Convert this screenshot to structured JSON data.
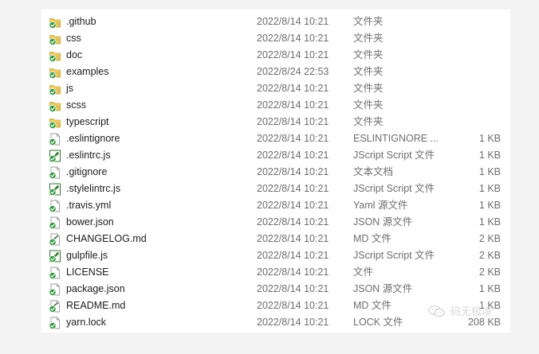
{
  "files": [
    {
      "name": ".github",
      "date": "2022/8/14 10:21",
      "type": "文件夹",
      "size": "",
      "icon": "folder-icon"
    },
    {
      "name": "css",
      "date": "2022/8/14 10:21",
      "type": "文件夹",
      "size": "",
      "icon": "folder-icon"
    },
    {
      "name": "doc",
      "date": "2022/8/14 10:21",
      "type": "文件夹",
      "size": "",
      "icon": "folder-icon"
    },
    {
      "name": "examples",
      "date": "2022/8/24 22:53",
      "type": "文件夹",
      "size": "",
      "icon": "folder-icon"
    },
    {
      "name": "js",
      "date": "2022/8/14 10:21",
      "type": "文件夹",
      "size": "",
      "icon": "folder-icon"
    },
    {
      "name": "scss",
      "date": "2022/8/14 10:21",
      "type": "文件夹",
      "size": "",
      "icon": "folder-icon"
    },
    {
      "name": "typescript",
      "date": "2022/8/14 10:21",
      "type": "文件夹",
      "size": "",
      "icon": "folder-icon"
    },
    {
      "name": ".eslintignore",
      "date": "2022/8/14 10:21",
      "type": "ESLINTIGNORE ...",
      "size": "1 KB",
      "icon": "file-icon"
    },
    {
      "name": ".eslintrc.js",
      "date": "2022/8/14 10:21",
      "type": "JScript Script 文件",
      "size": "1 KB",
      "icon": "script-file-icon"
    },
    {
      "name": ".gitignore",
      "date": "2022/8/14 10:21",
      "type": "文本文档",
      "size": "1 KB",
      "icon": "file-icon"
    },
    {
      "name": ".stylelintrc.js",
      "date": "2022/8/14 10:21",
      "type": "JScript Script 文件",
      "size": "1 KB",
      "icon": "script-file-icon"
    },
    {
      "name": ".travis.yml",
      "date": "2022/8/14 10:21",
      "type": "Yaml 源文件",
      "size": "1 KB",
      "icon": "file-icon"
    },
    {
      "name": "bower.json",
      "date": "2022/8/14 10:21",
      "type": "JSON 源文件",
      "size": "1 KB",
      "icon": "file-icon"
    },
    {
      "name": "CHANGELOG.md",
      "date": "2022/8/14 10:21",
      "type": "MD 文件",
      "size": "2 KB",
      "icon": "md-file-icon"
    },
    {
      "name": "gulpfile.js",
      "date": "2022/8/14 10:21",
      "type": "JScript Script 文件",
      "size": "2 KB",
      "icon": "script-file-icon"
    },
    {
      "name": "LICENSE",
      "date": "2022/8/14 10:21",
      "type": "文件",
      "size": "2 KB",
      "icon": "file-icon"
    },
    {
      "name": "package.json",
      "date": "2022/8/14 10:21",
      "type": "JSON 源文件",
      "size": "1 KB",
      "icon": "file-icon"
    },
    {
      "name": "README.md",
      "date": "2022/8/14 10:21",
      "type": "MD 文件",
      "size": "1 KB",
      "icon": "md-file-icon"
    },
    {
      "name": "yarn.lock",
      "date": "2022/8/14 10:21",
      "type": "LOCK 文件",
      "size": "208 KB",
      "icon": "file-icon"
    }
  ],
  "watermark": {
    "text": "码无极境",
    "icon": "wechat-icon"
  },
  "colors": {
    "folder": "#e8c14f",
    "check_badge": "#2f9a3c",
    "script_icon": "#2b7a2b",
    "text": "#1c1c1c",
    "secondary_text": "#6d6d6d"
  }
}
